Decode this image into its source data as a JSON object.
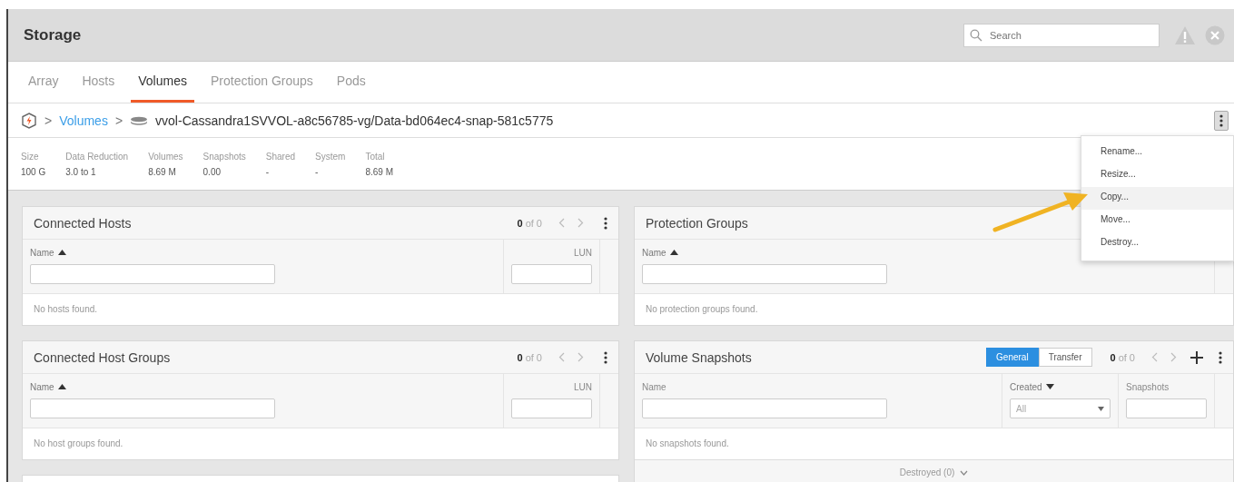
{
  "header": {
    "title": "Storage",
    "search": {
      "placeholder": "Search"
    }
  },
  "tabs": [
    {
      "label": "Array",
      "selected": false
    },
    {
      "label": "Hosts",
      "selected": false
    },
    {
      "label": "Volumes",
      "selected": true
    },
    {
      "label": "Protection Groups",
      "selected": false
    },
    {
      "label": "Pods",
      "selected": false
    }
  ],
  "breadcrumb": {
    "separator_1": ">",
    "link": "Volumes",
    "separator_2": ">",
    "current": "vvol-Cassandra1SVVOL-a8c56785-vg/Data-bd064ec4-snap-581c5775"
  },
  "stats": [
    {
      "label": "Size",
      "value": "100 G"
    },
    {
      "label": "Data Reduction",
      "value": "3.0 to 1"
    },
    {
      "label": "Volumes",
      "value": "8.69 M"
    },
    {
      "label": "Snapshots",
      "value": "0.00"
    },
    {
      "label": "Shared",
      "value": "-"
    },
    {
      "label": "System",
      "value": "-"
    },
    {
      "label": "Total",
      "value": "8.69 M"
    }
  ],
  "left_panels": [
    {
      "title": "Connected Hosts",
      "count": "0",
      "of_total": "of 0",
      "columns": [
        {
          "label": "Name",
          "sorted": true,
          "descending": false,
          "kind": "text"
        },
        {
          "label": "LUN",
          "sorted": false,
          "kind": "number"
        }
      ],
      "empty": "No hosts found."
    },
    {
      "title": "Connected Host Groups",
      "count": "0",
      "of_total": "of 0",
      "columns": [
        {
          "label": "Name",
          "sorted": true,
          "descending": false,
          "kind": "text"
        },
        {
          "label": "LUN",
          "sorted": false,
          "kind": "number"
        }
      ],
      "empty": "No host groups found."
    }
  ],
  "right_panels": [
    {
      "title": "Protection Groups",
      "columns": [
        {
          "label": "Name",
          "sorted": true,
          "descending": false,
          "kind": "text"
        }
      ],
      "empty": "No protection groups found."
    },
    {
      "title": "Volume Snapshots",
      "toggle": [
        {
          "label": "General",
          "selected": true
        },
        {
          "label": "Transfer",
          "selected": false
        }
      ],
      "count": "0",
      "of_total": "of 0",
      "add": true,
      "columns": [
        {
          "label": "Name",
          "sorted": false,
          "kind": "text"
        },
        {
          "label": "Created",
          "sorted": true,
          "descending": true,
          "kind": "select",
          "value": "All"
        },
        {
          "label": "Snapshots",
          "sorted": false,
          "kind": "text"
        }
      ],
      "empty": "No snapshots found.",
      "footer": "Destroyed (0)"
    }
  ],
  "menu": [
    {
      "label": "Rename...",
      "selected": false
    },
    {
      "label": "Resize...",
      "selected": false
    },
    {
      "label": "Copy...",
      "selected": true
    },
    {
      "label": "Move...",
      "selected": false
    },
    {
      "label": "Destroy...",
      "selected": false
    }
  ]
}
